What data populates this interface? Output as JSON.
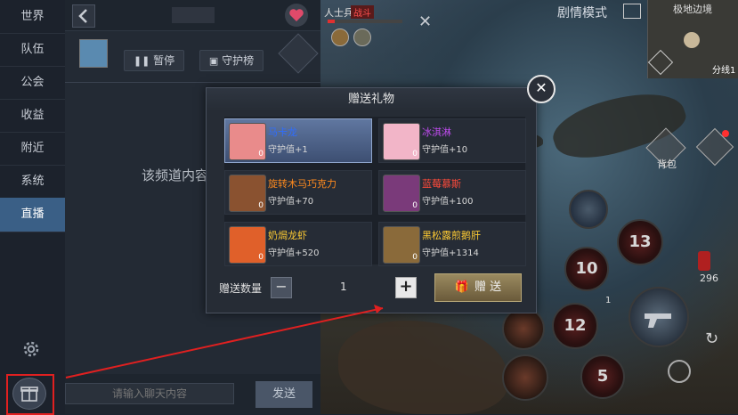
{
  "sidebar": {
    "items": [
      {
        "label": "世界"
      },
      {
        "label": "队伍"
      },
      {
        "label": "公会"
      },
      {
        "label": "收益"
      },
      {
        "label": "附近"
      },
      {
        "label": "系统"
      },
      {
        "label": "直播"
      }
    ],
    "active_index": 6
  },
  "chat": {
    "pause_label": "暂停",
    "guard_label": "守护榜",
    "empty_text": "该频道内容",
    "input_placeholder": "请输入聊天内容",
    "send_label": "发送"
  },
  "dialog": {
    "title": "赠送礼物",
    "gifts": [
      {
        "name": "马卡龙",
        "value": "守护值+1",
        "count": "0",
        "name_color": "#2e6dff",
        "icon_color": "#e98b8b"
      },
      {
        "name": "冰淇淋",
        "value": "守护值+10",
        "count": "0",
        "name_color": "#c04cf0",
        "icon_color": "#f2b5c8"
      },
      {
        "name": "旋转木马巧克力",
        "value": "守护值+70",
        "count": "0",
        "name_color": "#ff8a1e",
        "icon_color": "#8a5230"
      },
      {
        "name": "蓝莓慕斯",
        "value": "守护值+100",
        "count": "0",
        "name_color": "#ff4a3a",
        "icon_color": "#7a3a7a"
      },
      {
        "name": "奶焗龙虾",
        "value": "守护值+520",
        "count": "0",
        "name_color": "#ffcc33",
        "icon_color": "#e0602a"
      },
      {
        "name": "黑松露煎鹅肝",
        "value": "守护值+1314",
        "count": "0",
        "name_color": "#ffcc33",
        "icon_color": "#8a6a3a"
      }
    ],
    "quantity_label": "赠送数量",
    "quantity_value": "1",
    "give_label": "赠 送"
  },
  "hud": {
    "player_name": "人士兵",
    "player_tag": "战斗",
    "story_mode": "剧情模式",
    "map_name": "极地边境",
    "channel": "分线1",
    "backpack": "背包",
    "ammo": "296",
    "skills": [
      "13",
      "10",
      "12",
      "5"
    ],
    "skill_small": "1"
  }
}
